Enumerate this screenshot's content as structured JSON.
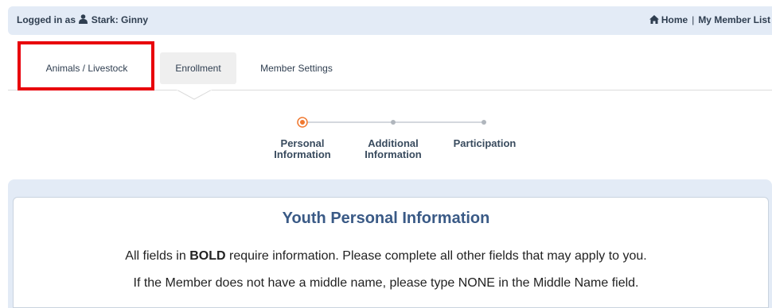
{
  "header": {
    "logged_in_prefix": "Logged in as",
    "user_name": "Stark: Ginny",
    "home_label": "Home",
    "separator": "|",
    "member_list_label": "My Member List",
    "user_icon": "user-icon",
    "home_icon": "home-icon"
  },
  "tabs": [
    {
      "label": "Animals / Livestock",
      "highlighted": true
    },
    {
      "label": "Enrollment",
      "active": true
    },
    {
      "label": "Member Settings"
    }
  ],
  "steps": [
    {
      "line1": "Personal",
      "line2": "Information",
      "status": "current"
    },
    {
      "line1": "Additional",
      "line2": "Information",
      "status": "pending"
    },
    {
      "line1": "Participation",
      "line2": "",
      "status": "pending"
    }
  ],
  "colors": {
    "accent_orange": "#f0782f",
    "highlight_red": "#e8000b",
    "title_blue": "#3a5a86",
    "topbar_bg": "#e3ebf6"
  },
  "main": {
    "title": "Youth Personal Information",
    "line1_pre": "All fields in",
    "line1_bold": "BOLD",
    "line1_post": "require information. Please complete all other fields that may apply to you.",
    "line2": "If the Member does not have a middle name, please type NONE in the Middle Name field."
  }
}
